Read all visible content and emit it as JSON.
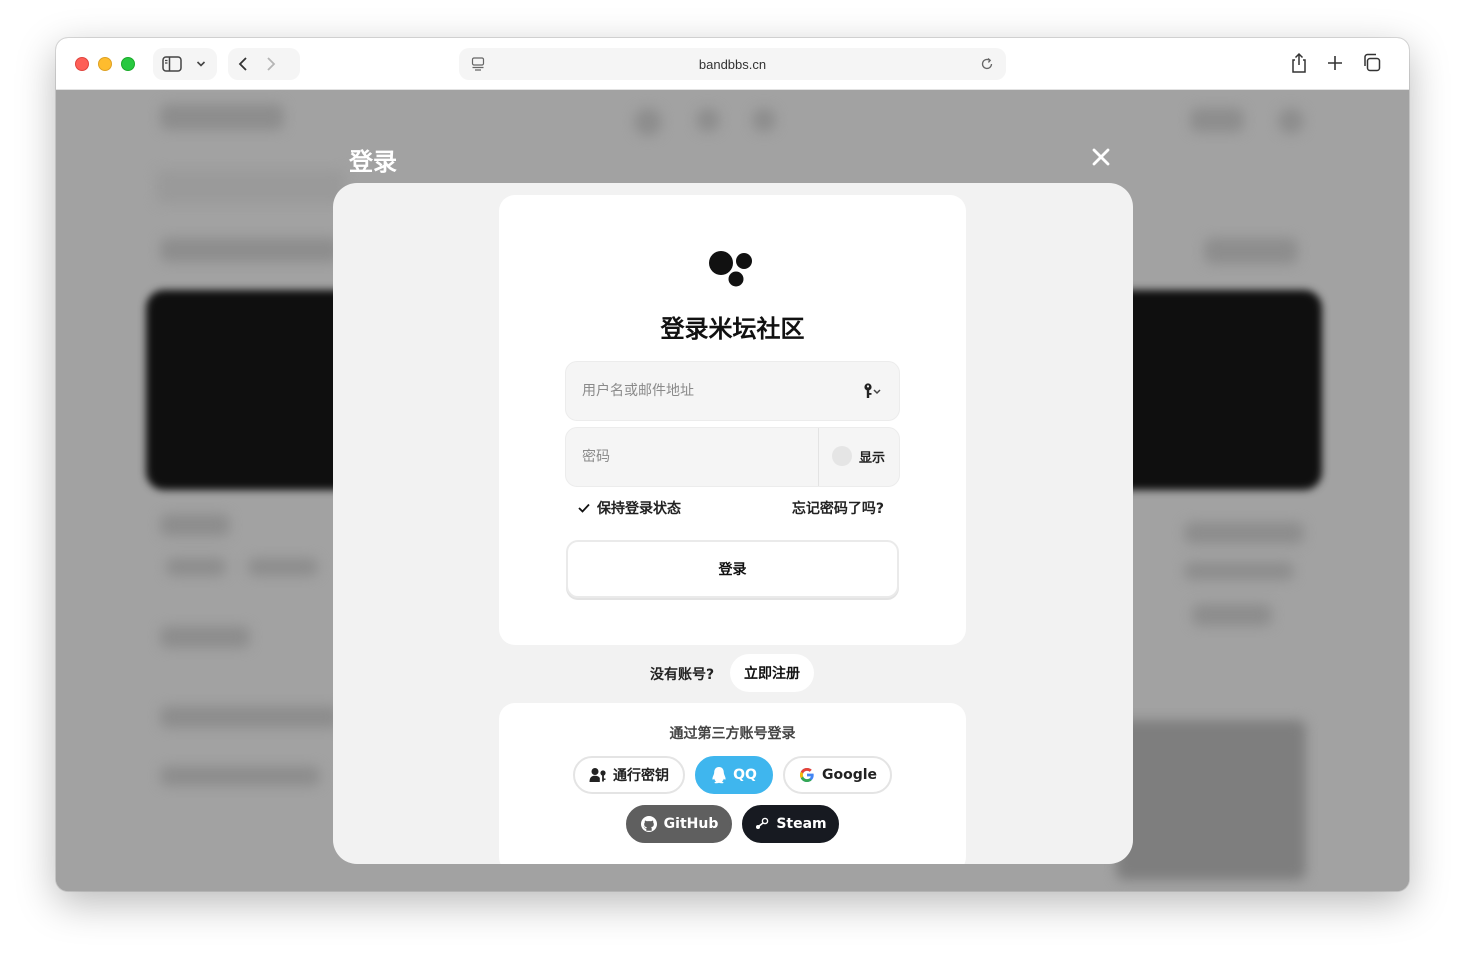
{
  "browser": {
    "address": "bandbbs.cn"
  },
  "modal": {
    "title": "登录",
    "heading": "登录米坛社区",
    "username_placeholder": "用户名或邮件地址",
    "password_placeholder": "密码",
    "show_label": "显示",
    "remember_label": "保持登录状态",
    "forgot_label": "忘记密码了吗?",
    "login_label": "登录",
    "no_account_label": "没有账号?",
    "register_label": "立即注册",
    "third_party_title": "通过第三方账号登录",
    "providers": {
      "passkey": "通行密钥",
      "qq": "QQ",
      "google": "Google",
      "github": "GitHub",
      "steam": "Steam"
    }
  },
  "colors": {
    "qq": "#3fb6ee",
    "github": "#5f5f5f",
    "steam": "#171a21"
  }
}
